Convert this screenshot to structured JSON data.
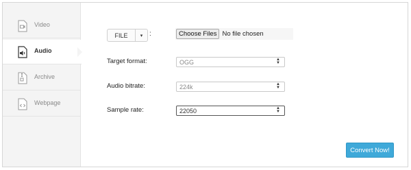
{
  "sidebar": {
    "items": [
      {
        "label": "Video",
        "icon": "video-file-icon"
      },
      {
        "label": "Audio",
        "icon": "audio-file-icon"
      },
      {
        "label": "Archive",
        "icon": "archive-file-icon"
      },
      {
        "label": "Webpage",
        "icon": "webpage-file-icon"
      }
    ],
    "active": "Audio"
  },
  "source": {
    "dropdown_label": "FILE",
    "dropdown_caret": "▾",
    "colon": ":",
    "choose_button": "Choose Files",
    "file_status": "No file chosen"
  },
  "form": {
    "target_format": {
      "label": "Target format:",
      "value": "OGG"
    },
    "audio_bitrate": {
      "label": "Audio bitrate:",
      "value": "224k"
    },
    "sample_rate": {
      "label": "Sample rate:",
      "value": "22050"
    }
  },
  "actions": {
    "convert_label": "Convert Now!"
  },
  "colors": {
    "accent": "#3fa9d9",
    "sidebar_bg": "#f4f4f4"
  }
}
